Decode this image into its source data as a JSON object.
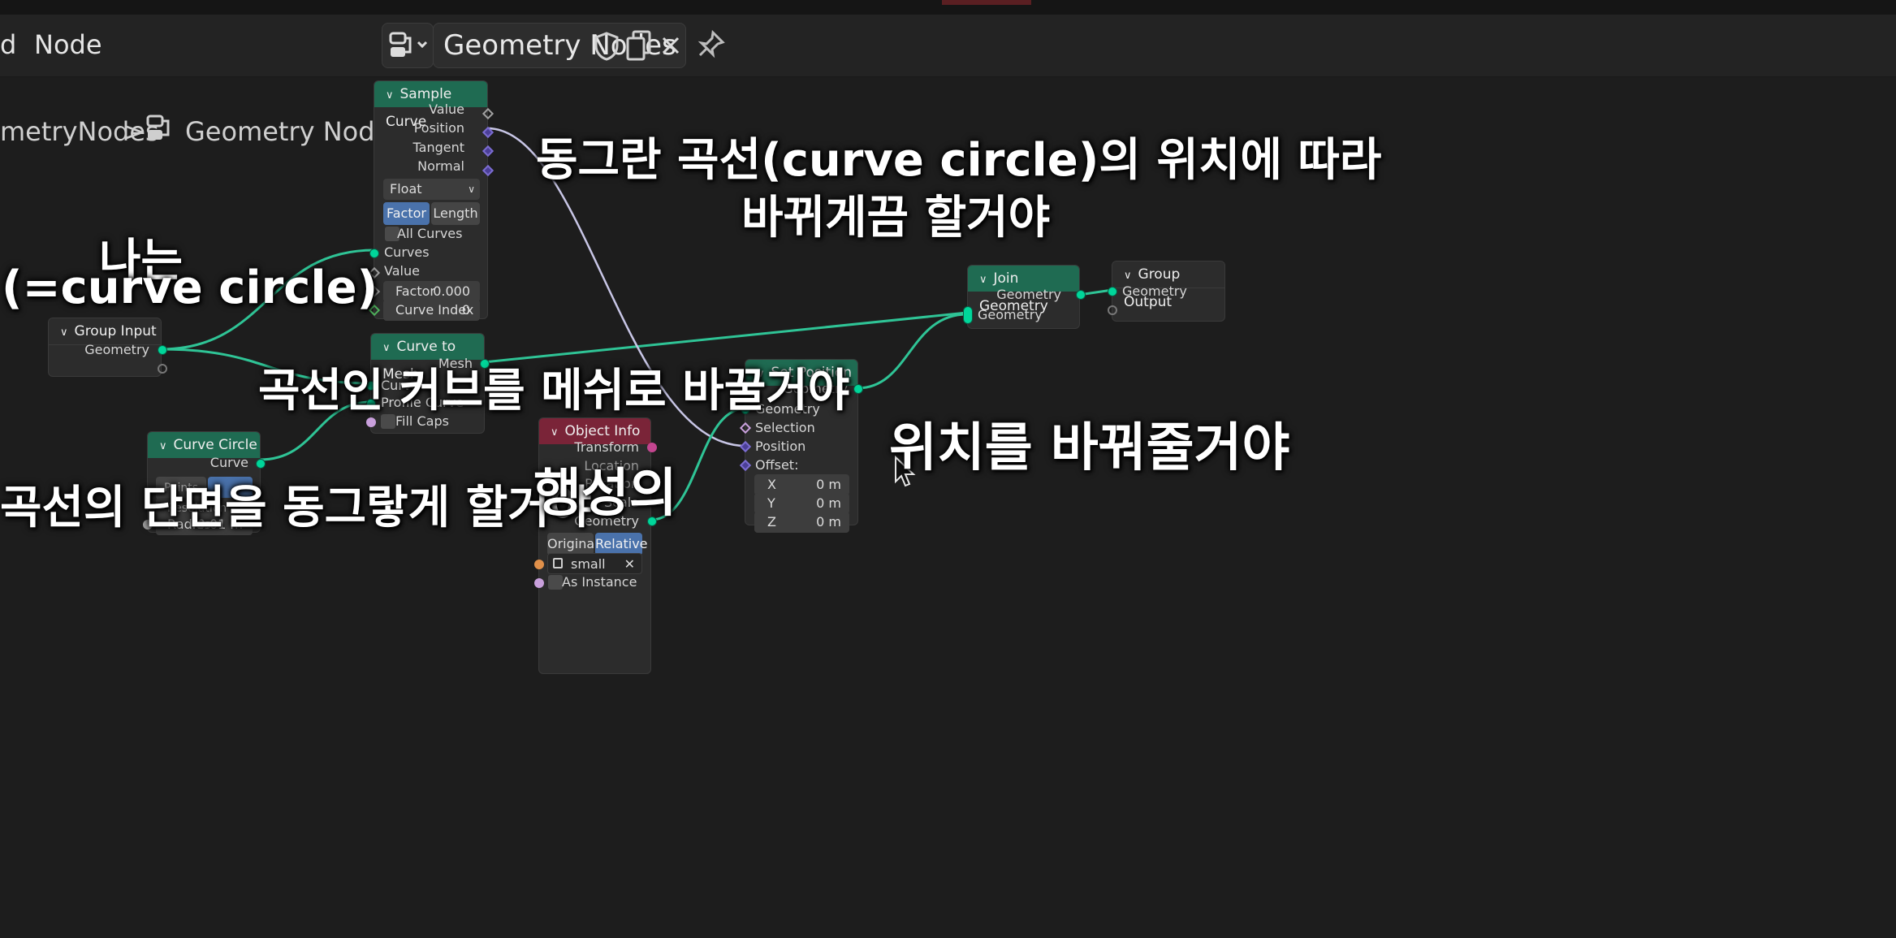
{
  "menu": {
    "view_partial": "d",
    "node": "Node"
  },
  "header": {
    "tree_name": "Geometry Nodes"
  },
  "breadcrumb": {
    "parent": "metryNodes",
    "separator": ">",
    "current": "Geometry Nodes"
  },
  "nodes": {
    "sample_curve": {
      "title": "Sample Curve",
      "outputs": [
        "Value",
        "Position",
        "Tangent",
        "Normal"
      ],
      "dtype": "Float",
      "mode_factor": "Factor",
      "mode_length": "Length",
      "all_curves": "All Curves",
      "in_curves": "Curves",
      "in_value": "Value",
      "factor_label": "Factor",
      "factor_value": "0.000",
      "curve_index_label": "Curve Index",
      "curve_index_value": "0"
    },
    "group_input": {
      "title": "Group Input",
      "geometry": "Geometry"
    },
    "curve_to_mesh": {
      "title": "Curve to Mesh",
      "mesh": "Mesh",
      "curve": "Curve",
      "profile_curve": "Profile Curve",
      "fill_caps": "Fill Caps"
    },
    "curve_circle": {
      "title": "Curve Circle",
      "curve": "Curve",
      "mode": "Points",
      "resolution": "Resolution",
      "radius_label": "Radius",
      "radius_value": "0.01 m"
    },
    "object_info": {
      "title": "Object Info",
      "transform": "Transform",
      "location": "Location",
      "rotation": "Rotation",
      "scale": "Scale",
      "geometry": "Geometry",
      "original": "Original",
      "relative": "Relative",
      "object": "small",
      "as_instance": "As Instance"
    },
    "set_position": {
      "title": "Set Position",
      "out_geometry": "Geometry",
      "in_geometry": "Geometry",
      "selection": "Selection",
      "position": "Position",
      "offset": "Offset:",
      "x_label": "X",
      "x_value": "0 m",
      "y_label": "Y",
      "y_value": "0 m",
      "z_label": "Z",
      "z_value": "0 m"
    },
    "join_geometry": {
      "title": "Join Geometry",
      "out_geometry": "Geometry",
      "in_geometry": "Geometry"
    },
    "group_output": {
      "title": "Group Output",
      "geometry": "Geometry"
    }
  },
  "captions": {
    "c1": "동그란 곡선(curve circle)의 위치에 따라",
    "c2": "바뀌게끔 할거야",
    "c3": "나는",
    "c4": "(=curve circle)",
    "c5": "곡선인 커브를 메쉬로 바꿀거야",
    "c6": "곡선의 단면을 동그랗게 할거야",
    "c7": "행성의",
    "c8": "위치를 바꿔줄거야"
  }
}
